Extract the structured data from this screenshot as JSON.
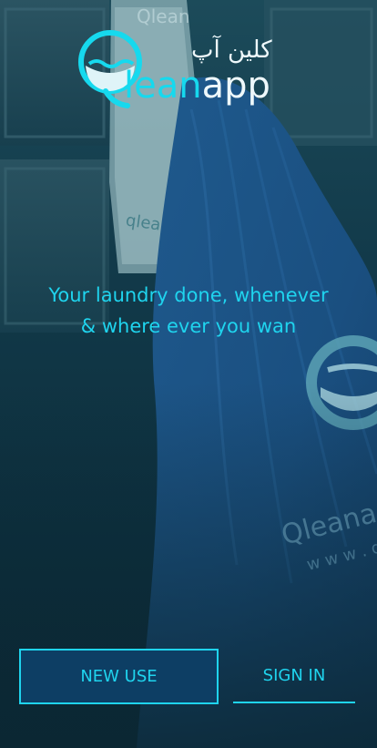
{
  "logo": {
    "arabic": "كلين آپ",
    "q_letter": "Q",
    "latin_lean": "lean",
    "latin_app": "app"
  },
  "tagline": {
    "line1": "Your laundry done, whenever",
    "line2": "& where ever you wan"
  },
  "actions": {
    "new_user_label": "NEW USE",
    "sign_in_label": "SIGN IN"
  },
  "background_decor": {
    "bag_print_1": "Qleanap",
    "bag_print_2": "w w w . q",
    "tag_print_1": "Qlean",
    "tag_print_2": "qlea"
  },
  "colors": {
    "accent": "#1fd4ee",
    "button_fill": "#0d3e64",
    "background": "#0e2f3a",
    "bag_blue": "#1c4f86"
  }
}
